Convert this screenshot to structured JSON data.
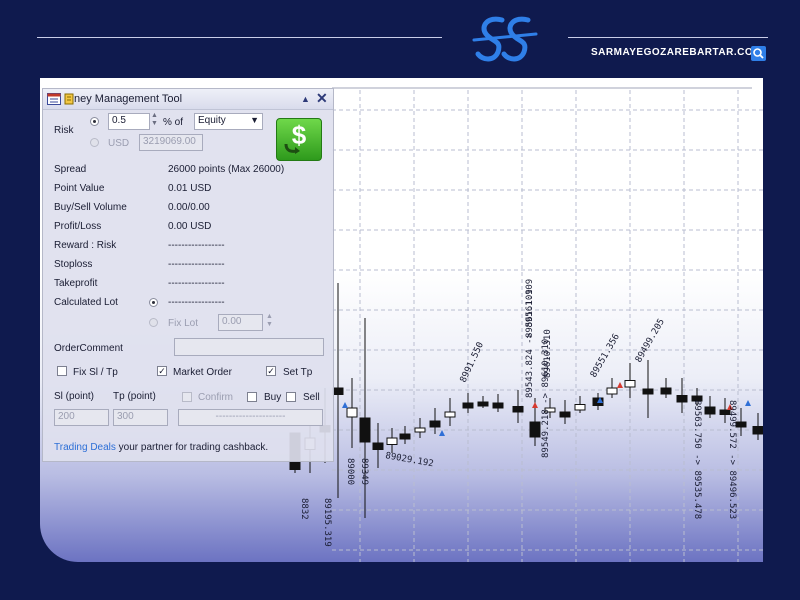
{
  "site": {
    "name": "SARMAYEGOZAREBARTAR.COM",
    "search_icon": "search-icon",
    "logo_icon": "ss-logo-icon",
    "accent": "#2f7fe8"
  },
  "panel": {
    "title": "ney Management Tool",
    "risk": {
      "label": "Risk",
      "percent_value": "0.5",
      "percent_of_label": "% of",
      "base_select": "Equity",
      "usd_label": "USD",
      "usd_value": "3219069.00"
    },
    "rows": [
      {
        "label": "Spread",
        "value": "26000 points  (Max 26000)"
      },
      {
        "label": "Point Value",
        "value": "0.01 USD"
      },
      {
        "label": "Buy/Sell Volume",
        "value": "0.00/0.00"
      },
      {
        "label": "Profit/Loss",
        "value": "0.00 USD"
      },
      {
        "label": "Reward : Risk",
        "value": "-----------------"
      },
      {
        "label": "Stoploss",
        "value": "-----------------"
      },
      {
        "label": "Takeprofit",
        "value": "-----------------"
      },
      {
        "label": "Calculated Lot",
        "value": "-----------------"
      }
    ],
    "fix_lot": {
      "label": "Fix Lot",
      "value": "0.00"
    },
    "order_comment": {
      "label": "OrderComment",
      "value": ""
    },
    "options": {
      "fix_sl_tp": "Fix Sl / Tp",
      "market_order": "Market Order",
      "set_tp": "Set Tp"
    },
    "sl": {
      "label": "Sl (point)",
      "value": "200"
    },
    "tp": {
      "label": "Tp (point)",
      "value": "300"
    },
    "confirm": "Confirm",
    "buy": "Buy",
    "sell": "Sell",
    "action_placeholder": "---------------------",
    "footer_link": "Trading Deals",
    "footer_text": " your partner for trading cashback."
  },
  "chart": {
    "labels": [
      "89029.192",
      "8991.550",
      "89561.109",
      "89610.310",
      "89543.824 -> 89561.109",
      "89549.218 -> 89610.310",
      "89551.356",
      "89499.205",
      "89563.750 -> 89535.478",
      "89499.572 -> 89496.523",
      "89195.319",
      "89000",
      "89349",
      "8832"
    ]
  }
}
